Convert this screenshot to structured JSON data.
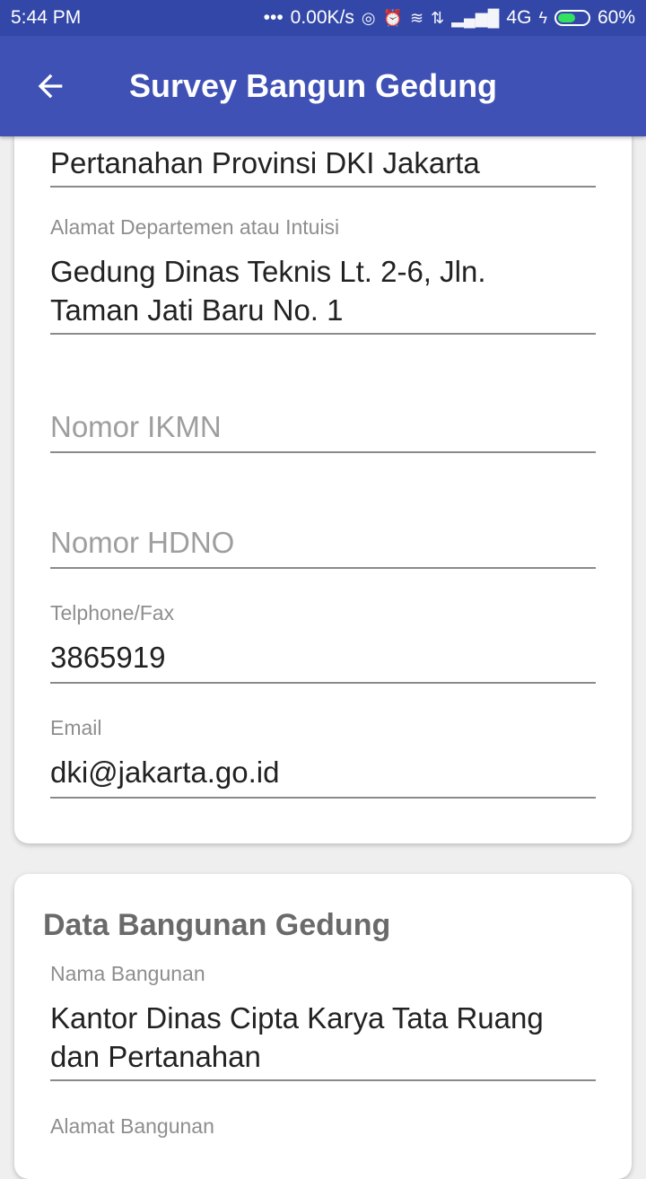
{
  "status": {
    "time": "5:44 PM",
    "dots": "•••",
    "speed": "0.00K/s",
    "network": "4G",
    "battery": "60%",
    "battery_level": 0.6
  },
  "appbar": {
    "title": "Survey Bangun Gedung"
  },
  "card1": {
    "partial_value": "Pertanahan Provinsi DKI Jakarta",
    "alamat_label": "Alamat Departemen atau Intuisi",
    "alamat_value_line1": "Gedung Dinas Teknis Lt. 2-6, Jln.",
    "alamat_value_line2": "Taman Jati Baru No. 1",
    "ikmn_placeholder": "Nomor IKMN",
    "hdno_placeholder": "Nomor HDNO",
    "telp_label": "Telphone/Fax",
    "telp_value": "3865919",
    "email_label": "Email",
    "email_value": "dki@jakarta.go.id"
  },
  "card2": {
    "title": "Data Bangunan Gedung",
    "nama_label": "Nama Bangunan",
    "nama_value_line1": "Kantor Dinas Cipta Karya Tata Ruang",
    "nama_value_line2": "dan Pertanahan",
    "alamat_label": "Alamat Bangunan"
  }
}
